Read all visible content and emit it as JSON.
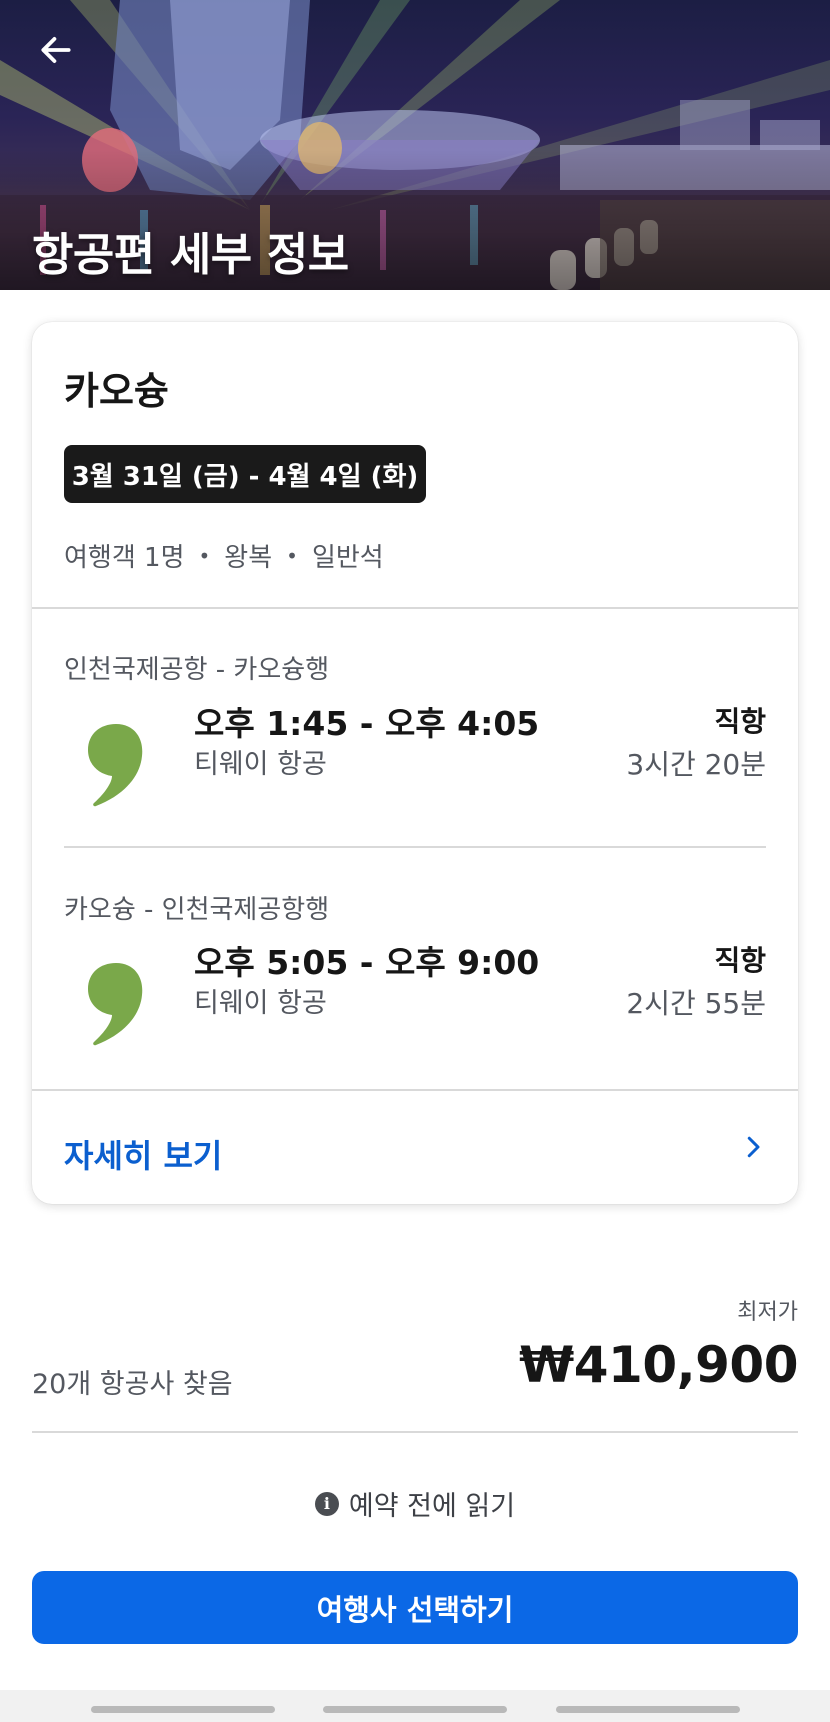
{
  "header": {
    "title": "항공편 세부 정보",
    "back_icon": "arrow-left-icon"
  },
  "search": {
    "destination": "카오슝",
    "date_range": "3월 31일 (금) - 4월 4일 (화)",
    "travelers": "여행객 1명",
    "trip_type": "왕복",
    "cabin_class": "일반석",
    "separator": "•"
  },
  "legs": [
    {
      "route": "인천국제공항 - 카오슝행",
      "time": "오후 1:45 - 오후 4:05",
      "airline": "티웨이 항공",
      "stops": "직항",
      "duration": "3시간 20분",
      "logo_icon": "tway-air-logo-icon",
      "logo_color": "#7aa84a"
    },
    {
      "route": "카오슝 - 인천국제공항행",
      "time": "오후 5:05 - 오후 9:00",
      "airline": "티웨이 항공",
      "stops": "직항",
      "duration": "2시간 55분",
      "logo_icon": "tway-air-logo-icon",
      "logo_color": "#7aa84a"
    }
  ],
  "details": {
    "label": "자세히 보기",
    "chevron_icon": "chevron-right-icon"
  },
  "pricing": {
    "caption": "최저가",
    "airlines_found": "20개 항공사 찾음",
    "price": "₩410,900"
  },
  "notice": {
    "icon": "info-icon",
    "icon_glyph": "i",
    "label": "예약 전에 읽기"
  },
  "cta": {
    "label": "여행사 선택하기"
  },
  "colors": {
    "accent": "#0b68e6",
    "link": "#0b5fcf",
    "badge_bg": "#1a1a1a",
    "airline_green": "#7aa84a"
  }
}
